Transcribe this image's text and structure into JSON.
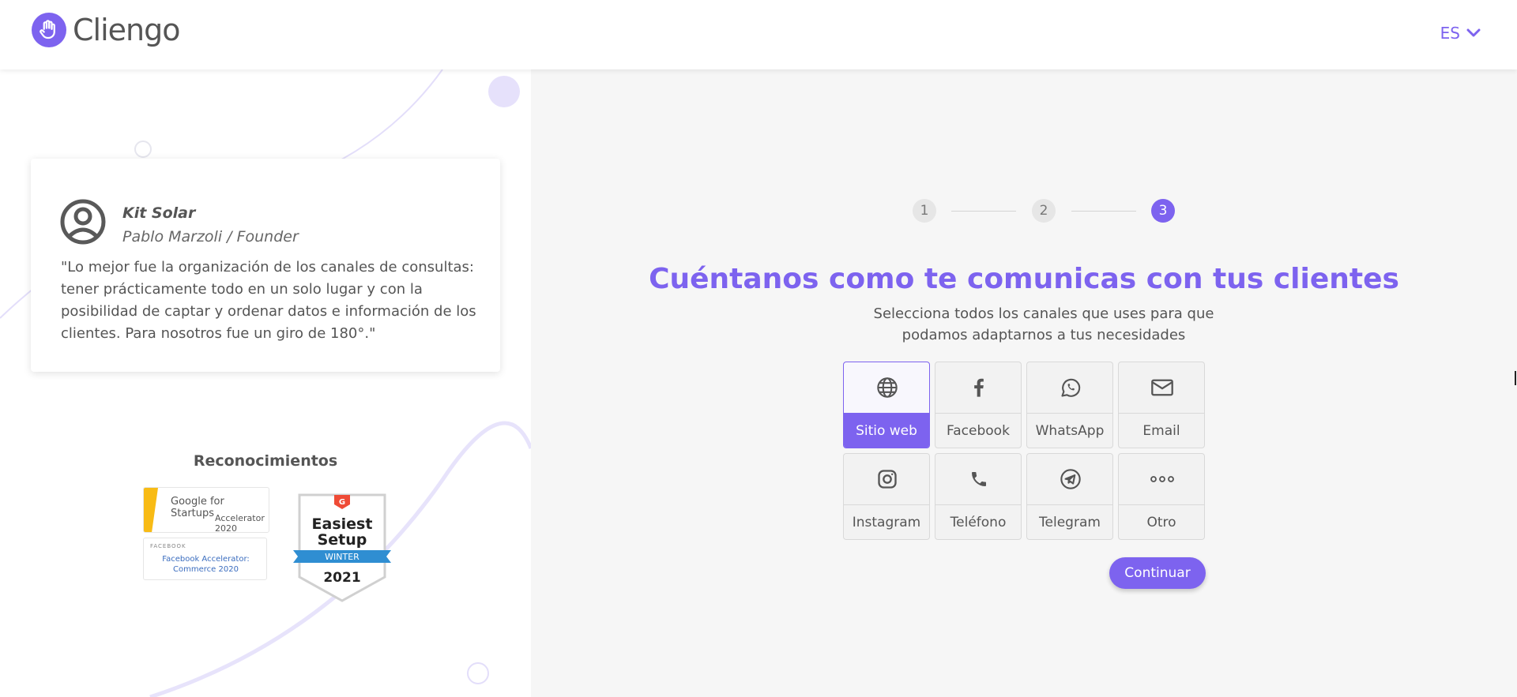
{
  "header": {
    "logo_text": "Cliengo",
    "language": "ES"
  },
  "testimonial": {
    "company": "Kit Solar",
    "author": "Pablo Marzoli / Founder",
    "quote": "\"Lo mejor fue la organización de los canales de consultas: tener prácticamente todo en un solo lugar y con la posibilidad de captar y ordenar datos e información de los clientes. Para nosotros fue un giro de 180°.\""
  },
  "recognitions": {
    "title": "Reconocimientos",
    "google_badge": {
      "line1": "Google for Startups",
      "line2": "Accelerator 2020"
    },
    "facebook_badge": {
      "header": "FACEBOOK",
      "line1": "Facebook Accelerator:",
      "line2": "Commerce 2020"
    },
    "g2_badge": {
      "line1": "Easiest",
      "line2": "Setup",
      "ribbon": "WINTER",
      "year": "2021"
    }
  },
  "stepper": {
    "steps": [
      "1",
      "2",
      "3"
    ],
    "active_step": 3
  },
  "main": {
    "title": "Cuéntanos como te comunicas con tus clientes",
    "subtitle_line1": "Selecciona todos los canales que uses para que",
    "subtitle_line2": "podamos adaptarnos a tus necesidades",
    "channels": [
      {
        "label": "Sitio web",
        "icon": "globe-icon",
        "selected": true
      },
      {
        "label": "Facebook",
        "icon": "facebook-icon",
        "selected": false
      },
      {
        "label": "WhatsApp",
        "icon": "whatsapp-icon",
        "selected": false
      },
      {
        "label": "Email",
        "icon": "email-icon",
        "selected": false
      },
      {
        "label": "Instagram",
        "icon": "instagram-icon",
        "selected": false
      },
      {
        "label": "Teléfono",
        "icon": "phone-icon",
        "selected": false
      },
      {
        "label": "Telegram",
        "icon": "telegram-icon",
        "selected": false
      },
      {
        "label": "Otro",
        "icon": "more-icon",
        "selected": false
      }
    ],
    "continue_label": "Continuar"
  },
  "colors": {
    "accent": "#7d63ef",
    "background": "#f6f6f6",
    "text": "#555555"
  }
}
